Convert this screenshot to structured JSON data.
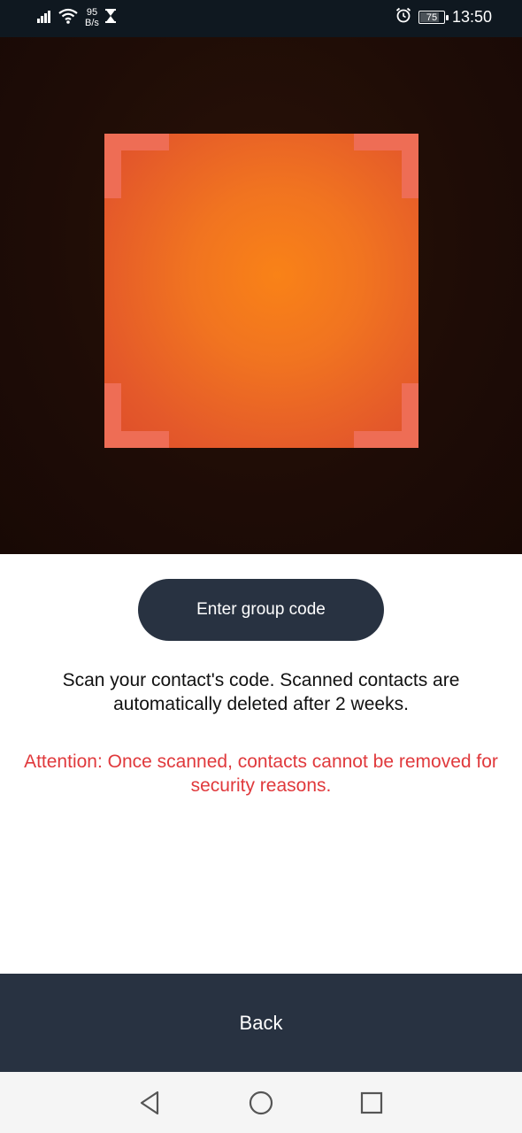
{
  "status_bar": {
    "net_speed_value": "95",
    "net_speed_unit": "B/s",
    "battery_level": "75",
    "time": "13:50",
    "icons": [
      "signal-icon",
      "wifi-icon",
      "hourglass-icon",
      "alarm-icon",
      "battery-icon"
    ]
  },
  "scanner": {
    "frame_color": "#f17420",
    "corner_color": "#ee6d55"
  },
  "actions": {
    "enter_group_code_label": "Enter group code"
  },
  "messages": {
    "info": "Scan your contact's code. Scanned contacts are automatically deleted after 2 weeks.",
    "warning": "Attention: Once scanned, contacts cannot be removed for security reasons.",
    "warning_color": "#e0393c"
  },
  "footer": {
    "back_label": "Back"
  },
  "nav": {
    "buttons": [
      "back-triangle-icon",
      "home-circle-icon",
      "recents-square-icon"
    ]
  }
}
